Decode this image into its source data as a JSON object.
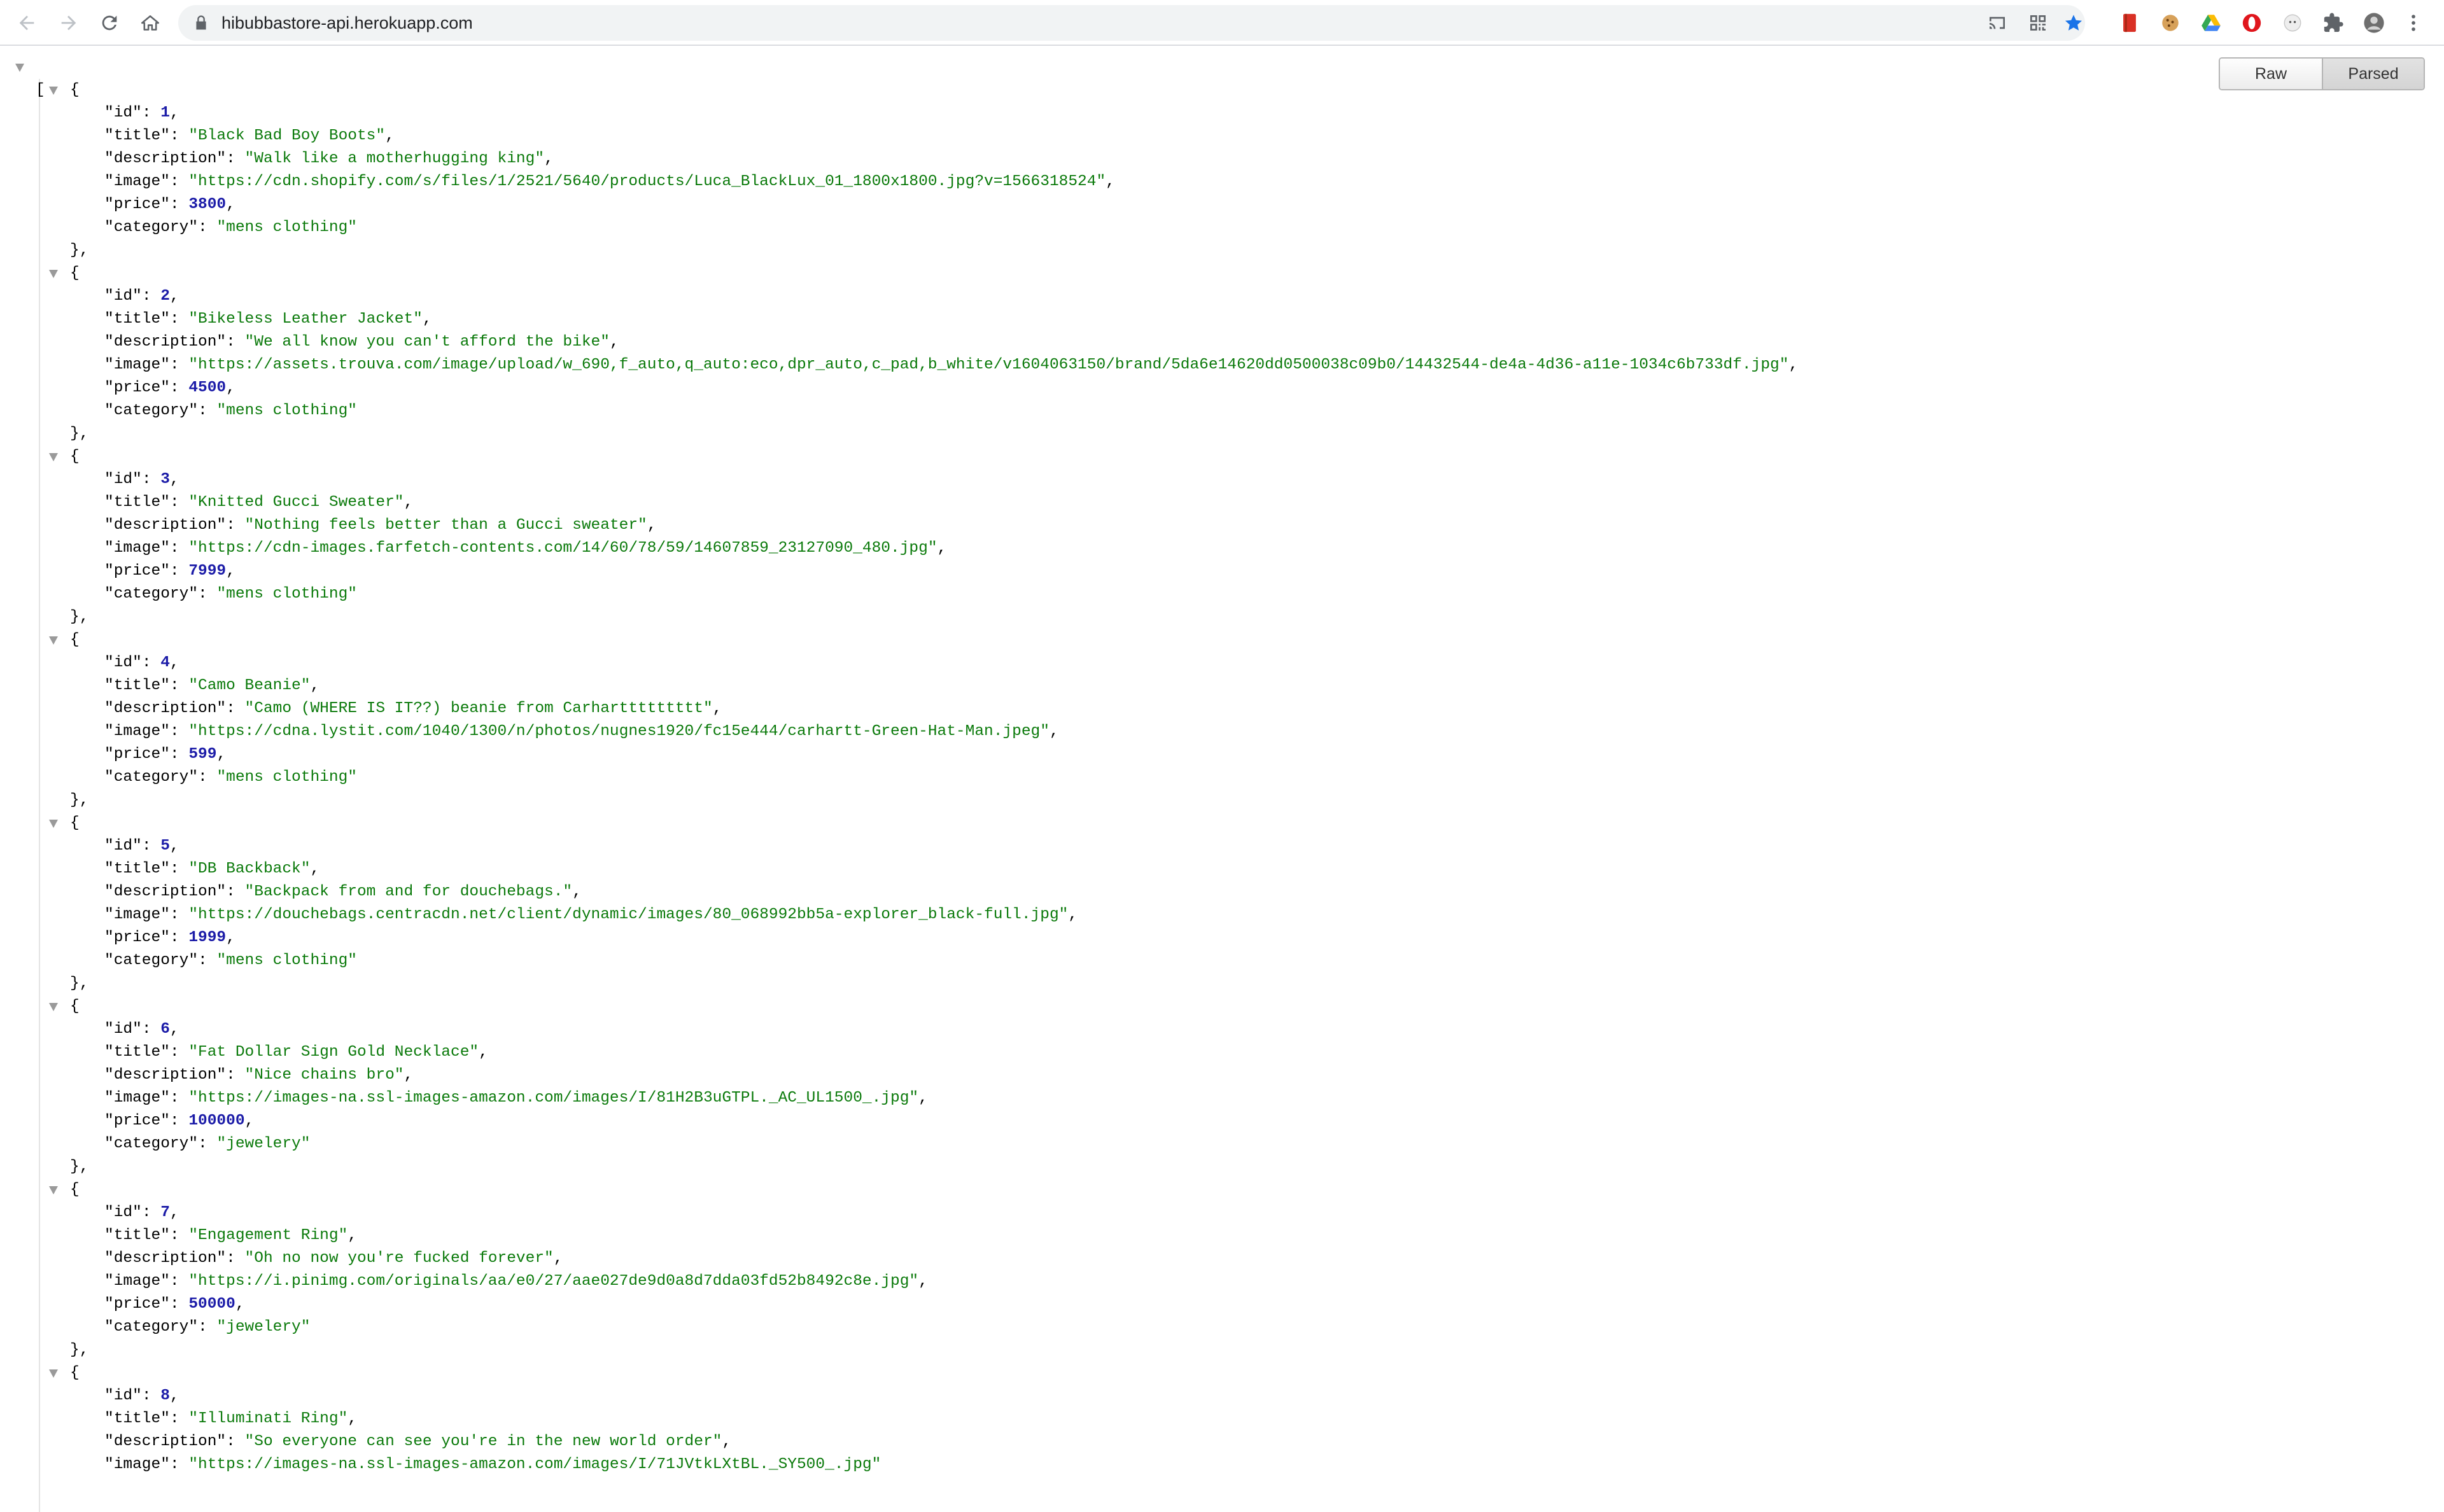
{
  "browser": {
    "url": "hibubbastore-api.herokuapp.com",
    "icons": {
      "back": "back-arrow-icon",
      "forward": "forward-arrow-icon",
      "reload": "reload-icon",
      "home": "home-icon",
      "lock": "lock-icon",
      "cast": "cast-icon",
      "qr": "qr-code-icon",
      "bookmark": "bookmark-star-icon",
      "extensions": [
        "red-book-extension-icon",
        "cookie-extension-icon",
        "google-drive-icon",
        "opera-extension-icon",
        "ghost-extension-icon",
        "puzzle-extensions-icon"
      ],
      "profile": "profile-avatar-icon",
      "menu": "kebab-menu-icon"
    },
    "colors": {
      "accent": "#1a73e8",
      "bookmark_star": "#1a73e8"
    }
  },
  "viewer": {
    "raw_label": "Raw",
    "parsed_label": "Parsed",
    "active_mode": "Parsed",
    "colors": {
      "string": "#0b7a0b",
      "number": "#1c1ca8",
      "toggle": "#9a9a9a"
    }
  },
  "json": {
    "open_bracket": "[",
    "items": [
      {
        "id": "1",
        "title": "\"Black Bad Boy Boots\"",
        "description": "\"Walk like a motherhugging king\"",
        "image": "\"https://cdn.shopify.com/s/files/1/2521/5640/products/Luca_BlackLux_01_1800x1800.jpg?v=1566318524\"",
        "price": "3800",
        "category": "\"mens clothing\""
      },
      {
        "id": "2",
        "title": "\"Bikeless Leather Jacket\"",
        "description": "\"We all know you can't afford the bike\"",
        "image": "\"https://assets.trouva.com/image/upload/w_690,f_auto,q_auto:eco,dpr_auto,c_pad,b_white/v1604063150/brand/5da6e14620dd0500038c09b0/14432544-de4a-4d36-a11e-1034c6b733df.jpg\"",
        "price": "4500",
        "category": "\"mens clothing\""
      },
      {
        "id": "3",
        "title": "\"Knitted Gucci Sweater\"",
        "description": "\"Nothing feels better than a Gucci sweater\"",
        "image": "\"https://cdn-images.farfetch-contents.com/14/60/78/59/14607859_23127090_480.jpg\"",
        "price": "7999",
        "category": "\"mens clothing\""
      },
      {
        "id": "4",
        "title": "\"Camo Beanie\"",
        "description": "\"Camo (WHERE IS IT??) beanie from Carharttttttttt\"",
        "image": "\"https://cdna.lystit.com/1040/1300/n/photos/nugnes1920/fc15e444/carhartt-Green-Hat-Man.jpeg\"",
        "price": "599",
        "category": "\"mens clothing\""
      },
      {
        "id": "5",
        "title": "\"DB Backback\"",
        "description": "\"Backpack from and for douchebags.\"",
        "image": "\"https://douchebags.centracdn.net/client/dynamic/images/80_068992bb5a-explorer_black-full.jpg\"",
        "price": "1999",
        "category": "\"mens clothing\""
      },
      {
        "id": "6",
        "title": "\"Fat Dollar Sign Gold Necklace\"",
        "description": "\"Nice chains bro\"",
        "image": "\"https://images-na.ssl-images-amazon.com/images/I/81H2B3uGTPL._AC_UL1500_.jpg\"",
        "price": "100000",
        "category": "\"jewelery\""
      },
      {
        "id": "7",
        "title": "\"Engagement Ring\"",
        "description": "\"Oh no now you're fucked forever\"",
        "image": "\"https://i.pinimg.com/originals/aa/e0/27/aae027de9d0a8d7dda03fd52b8492c8e.jpg\"",
        "price": "50000",
        "category": "\"jewelery\""
      },
      {
        "id": "8",
        "title": "\"Illuminati Ring\"",
        "description": "\"So everyone can see you're in the new world order\"",
        "image": "\"https://images-na.ssl-images-amazon.com/images/I/71JVtkLXtBL._SY500_.jpg\""
      }
    ]
  }
}
